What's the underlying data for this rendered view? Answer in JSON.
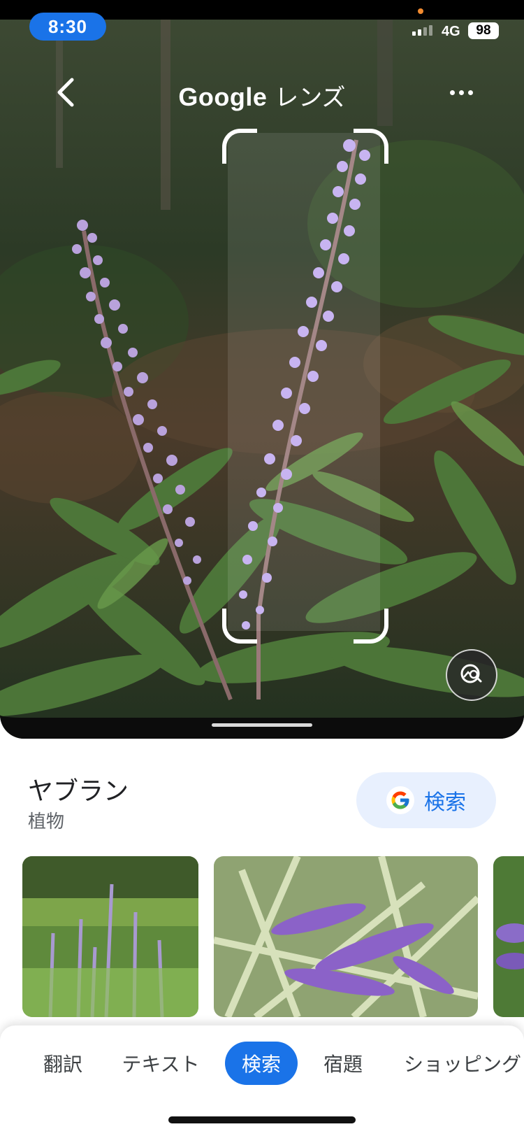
{
  "status_bar": {
    "time": "8:30",
    "network": "4G",
    "battery": "98"
  },
  "top_bar": {
    "title_brand": "Google",
    "title_product": "レンズ",
    "icons": [
      "chevron-left-icon",
      "more-vert-icon"
    ]
  },
  "image_viewer": {
    "subject": "flowering spike plants with purple blossoms",
    "icons": [
      "crop-corner-icon",
      "image-search-icon"
    ]
  },
  "result": {
    "name": "ヤブラン",
    "type": "植物",
    "search_button_label": "検索",
    "search_button_icon": "google-g-icon",
    "thumbnails": [
      "thumbnail-1",
      "thumbnail-2",
      "thumbnail-3"
    ]
  },
  "mode_tabs": {
    "items": [
      {
        "label": "翻訳",
        "selected": false
      },
      {
        "label": "テキスト",
        "selected": false
      },
      {
        "label": "検索",
        "selected": true
      },
      {
        "label": "宿題",
        "selected": false
      },
      {
        "label": "ショッピング",
        "selected": false
      }
    ]
  },
  "colors": {
    "accent": "#1a73e8",
    "pill_bg": "#e8f0fe",
    "flower": "#b9a2dc",
    "foliage": "#4f7a3a"
  }
}
